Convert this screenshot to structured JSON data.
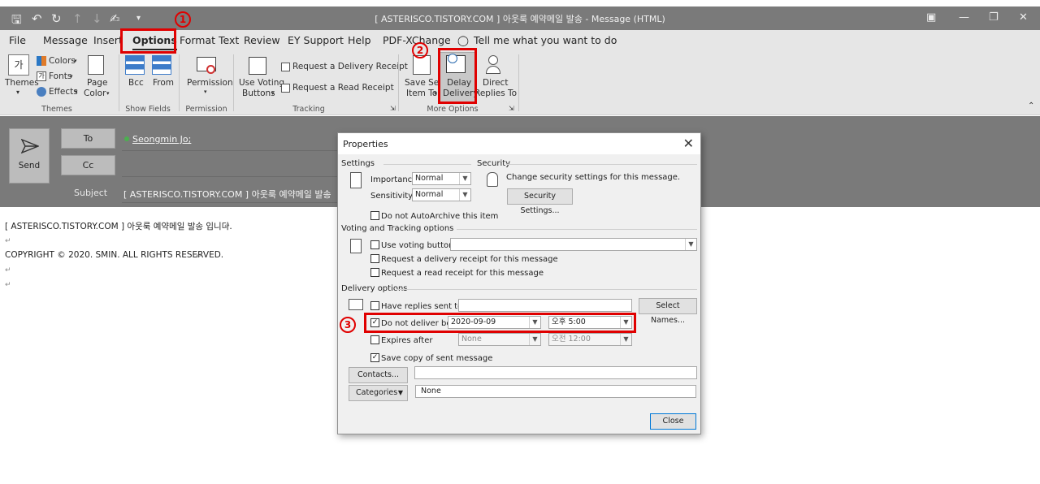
{
  "window": {
    "title": "[ ASTERISCO.TISTORY.COM ] 아웃룩 예약메일 발송  -  Message (HTML)"
  },
  "tabs": [
    {
      "label": "File"
    },
    {
      "label": "Message"
    },
    {
      "label": "Insert"
    },
    {
      "label": "Options"
    },
    {
      "label": "Format Text"
    },
    {
      "label": "Review"
    },
    {
      "label": "EY Support"
    },
    {
      "label": "Help"
    },
    {
      "label": "PDF-XChange"
    }
  ],
  "tell_me": "Tell me what you want to do",
  "ribbon": {
    "themes": {
      "themes": "Themes",
      "colors": "Colors",
      "fonts": "Fonts",
      "effects": "Effects",
      "page_color_1": "Page",
      "page_color_2": "Color",
      "group": "Themes",
      "icon_text": "가"
    },
    "show_fields": {
      "bcc": "Bcc",
      "from": "From",
      "group": "Show Fields"
    },
    "permission": {
      "label": "Permission",
      "group": "Permission"
    },
    "tracking": {
      "voting_1": "Use Voting",
      "voting_2": "Buttons",
      "delivery_receipt": "Request a Delivery Receipt",
      "read_receipt": "Request a Read Receipt",
      "group": "Tracking"
    },
    "more_options": {
      "save_sent_1": "Save Sent",
      "save_sent_2": "Item To",
      "delay_1": "Delay",
      "delay_2": "Delivery",
      "direct_1": "Direct",
      "direct_2": "Replies To",
      "group": "More Options"
    }
  },
  "compose": {
    "send": "Send",
    "to": "To",
    "cc": "Cc",
    "to_value": "Seongmin Jo;",
    "subject_label": "Subject",
    "subject_value": "[ ASTERISCO.TISTORY.COM ] 아웃룩 예약메일 발송"
  },
  "body": {
    "line1": "[ ASTERISCO.TISTORY.COM ] 아웃룩 예약메일 발송 입니다.",
    "line3": "COPYRIGHT © 2020. SMIN. ALL RIGHTS RESERVED."
  },
  "dialog": {
    "title": "Properties",
    "settings": "Settings",
    "importance_label": "Importance",
    "importance_value": "Normal",
    "sensitivity_label": "Sensitivity",
    "sensitivity_value": "Normal",
    "security": "Security",
    "security_text": "Change security settings for this message.",
    "security_button": "Security Settings...",
    "no_autoarchive": "Do not AutoArchive this item",
    "voting_section": "Voting and Tracking options",
    "use_voting": "Use voting buttons",
    "req_delivery": "Request a delivery receipt for this message",
    "req_read": "Request a read receipt for this message",
    "delivery_section": "Delivery options",
    "have_replies": "Have replies sent to",
    "select_names": "Select Names...",
    "do_not_deliver": "Do not deliver before",
    "deliver_date": "2020-09-09",
    "deliver_time": "오후 5:00",
    "expires_after": "Expires after",
    "expires_date": "None",
    "expires_time": "오전 12:00",
    "save_copy": "Save copy of sent message",
    "contacts_button": "Contacts...",
    "categories_button": "Categories",
    "categories_value": "None",
    "close_button": "Close"
  },
  "annotations": {
    "n1": "1",
    "n2": "2",
    "n3": "3"
  }
}
